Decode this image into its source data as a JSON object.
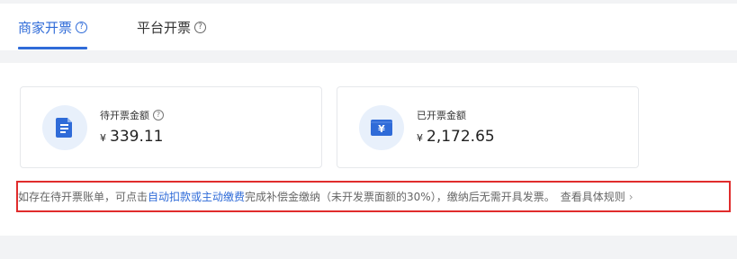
{
  "tabs": [
    {
      "label": "商家开票",
      "active": true
    },
    {
      "label": "平台开票",
      "active": false
    }
  ],
  "cards": [
    {
      "label": "待开票金额",
      "currency": "¥",
      "amount": "339.11",
      "icon": "document-icon"
    },
    {
      "label": "已开票金额",
      "currency": "¥",
      "amount": "2,172.65",
      "icon": "yen-folder-icon"
    }
  ],
  "notice": {
    "text_before": "如存在待开票账单，可点击",
    "link_text": "自动扣款或主动缴费",
    "text_after": "完成补偿金缴纳（未开发票面额的30%），缴纳后无需开具发票。",
    "more_text": "查看具体规则",
    "chevron": "›"
  },
  "colors": {
    "accent": "#2f6bd8",
    "highlight_border": "#e02c2c",
    "background": "#f2f3f5"
  }
}
